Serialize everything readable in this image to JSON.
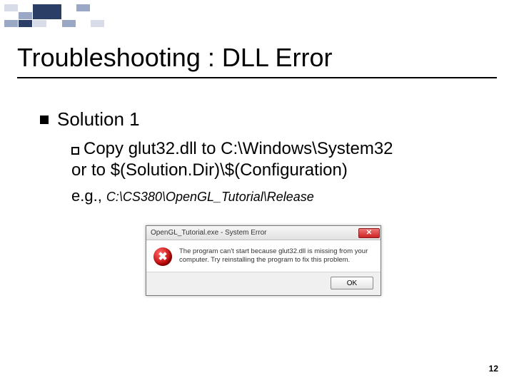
{
  "slide": {
    "title": "Troubleshooting : DLL Error",
    "page_number": "12",
    "bullet1": "Solution 1",
    "bullet2_line1": "Copy glut32.dll to C:\\Windows\\System32",
    "bullet2_line2": "or to $(Solution.Dir)\\$(Configuration)",
    "eg_prefix": "e.g., ",
    "eg_path": "C:\\CS380\\OpenGL_Tutorial\\Release"
  },
  "dialog": {
    "title": "OpenGL_Tutorial.exe - System Error",
    "close_glyph": "✕",
    "icon_glyph": "✖",
    "message_line1": "The program can't start because glut32.dll is missing from your",
    "message_line2": "computer. Try reinstalling the program to fix this problem.",
    "ok_label": "OK"
  }
}
